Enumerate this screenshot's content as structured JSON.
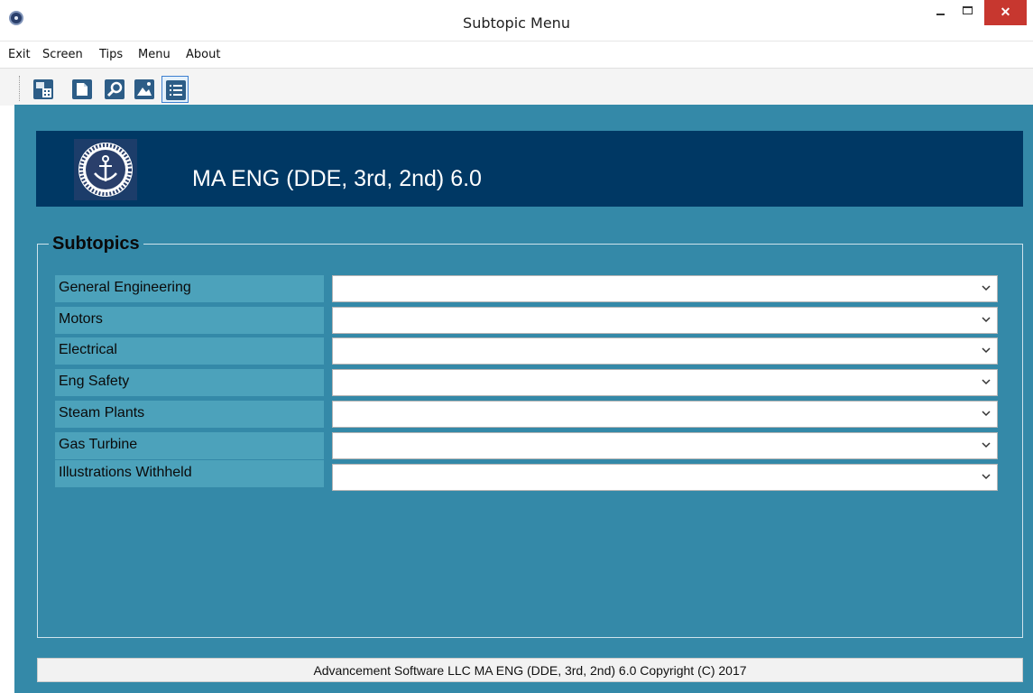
{
  "window": {
    "title": "Subtopic Menu",
    "close_glyph": "✕"
  },
  "menubar": {
    "items": [
      {
        "label": "Exit"
      },
      {
        "label": "Screen"
      },
      {
        "label": "Tips"
      },
      {
        "label": "Menu"
      },
      {
        "label": "About"
      }
    ]
  },
  "toolbar": {
    "buttons": [
      {
        "icon": "calculator-icon"
      },
      {
        "icon": "new-document-icon"
      },
      {
        "icon": "search-icon"
      },
      {
        "icon": "image-icon"
      },
      {
        "icon": "list-icon",
        "active": true
      }
    ]
  },
  "banner": {
    "title": "MA ENG (DDE, 3rd, 2nd) 6.0",
    "logo_icon": "anchor-emblem-icon"
  },
  "subtopics": {
    "heading": "Subtopics",
    "rows": [
      {
        "label": "General Engineering",
        "selected": ""
      },
      {
        "label": "Motors",
        "selected": ""
      },
      {
        "label": "Electrical",
        "selected": ""
      },
      {
        "label": "Eng Safety",
        "selected": ""
      },
      {
        "label": "Steam Plants",
        "selected": ""
      },
      {
        "label": "Gas Turbine",
        "selected": ""
      },
      {
        "label": "Illustrations Withheld",
        "selected": ""
      }
    ]
  },
  "footer": {
    "text": "Advancement Software LLC MA ENG (DDE, 3rd, 2nd) 6.0 Copyright (C) 2017"
  },
  "colors": {
    "background": "#3489a8",
    "banner": "#003864",
    "label_bg": "#4ca2bb",
    "close_button": "#c7372f"
  }
}
